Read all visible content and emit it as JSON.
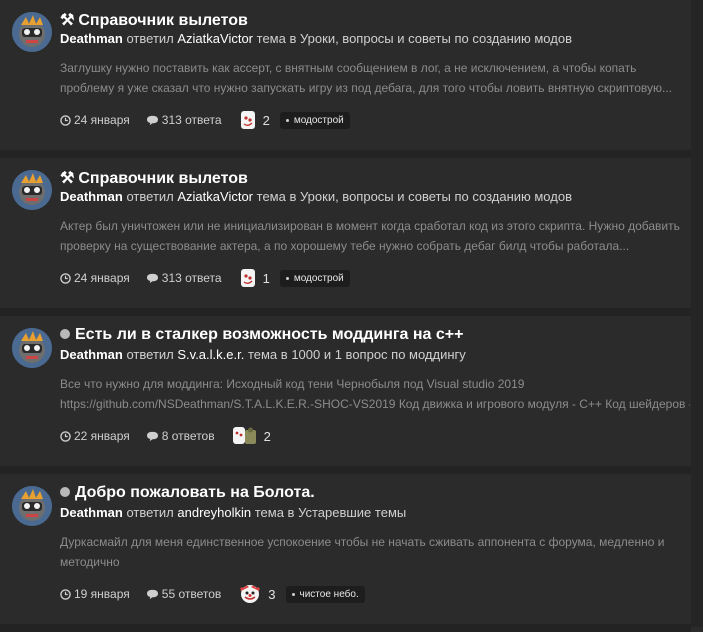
{
  "posts": [
    {
      "title_prefix": "⚒",
      "title": "Справочник вылетов",
      "author": "Deathman",
      "action": "ответил",
      "recipient": "AziatkaVictor",
      "in_text": "тема в",
      "forum": "Уроки, вопросы и советы по созданию модов",
      "excerpt_line1": "Заглушку нужно поставить как ассерт, с внятным сообщением в лог, а не исключением, а чтобы копать",
      "excerpt_line2": "проблему я уже сказал что нужно запускать игру из под дебага, для того чтобы ловить внятную скриптовую...",
      "date": "24 января",
      "replies": "313 ответа",
      "reaction_count": "2",
      "tag": "модострой"
    },
    {
      "title_prefix": "⚒",
      "title": "Справочник вылетов",
      "author": "Deathman",
      "action": "ответил",
      "recipient": "AziatkaVictor",
      "in_text": "тема в",
      "forum": "Уроки, вопросы и советы по созданию модов",
      "excerpt_line1": "Актер был уничтожен или не инициализирован в момент когда сработал код из этого скрипта. Нужно добавить",
      "excerpt_line2": "проверку на существование актера, а по хорошему тебе нужно собрать дебаг билд чтобы работала...",
      "date": "24 января",
      "replies": "313 ответа",
      "reaction_count": "1",
      "tag": "модострой"
    },
    {
      "title_prefix": "",
      "title": "Есть ли в сталкер возможность моддинга на с++",
      "author": "Deathman",
      "action": "ответил",
      "recipient": "S.v.a.l.k.e.r.",
      "in_text": "тема в",
      "forum": "1000 и 1 вопрос по моддингу",
      "excerpt_line1": "Все что нужно для моддинга: Исходный код тени Чернобыля под Visual studio 2019",
      "excerpt_line2": "https://github.com/NSDeathman/S.T.A.L.K.E.R.-SHOC-VS2019 Код движка и игрового модуля - C++ Код шейдеров -...",
      "date": "22 января",
      "replies": "8 ответов",
      "reaction_count": "2",
      "tag": ""
    },
    {
      "title_prefix": "",
      "title": "Добро пожаловать на Болота.",
      "author": "Deathman",
      "action": "ответил",
      "recipient": "andreyholkin",
      "in_text": "тема в",
      "forum": "Устаревшие темы",
      "excerpt_line1": "Дуркасмайл для меня единственное успокоение чтобы не начать сживать аппонента с форума, медленно и",
      "excerpt_line2": "методично",
      "date": "19 января",
      "replies": "55 ответов",
      "reaction_count": "3",
      "tag": "чистое небо."
    }
  ],
  "icons": {
    "clock": "clock-icon",
    "comment": "comment-icon",
    "reaction": "reaction-icon",
    "avatar": "avatar"
  },
  "colors": {
    "background": "#2b2b2b",
    "separator": "#232323",
    "tag_bg": "#1d1d1d",
    "muted_text": "#8c8c8c"
  }
}
